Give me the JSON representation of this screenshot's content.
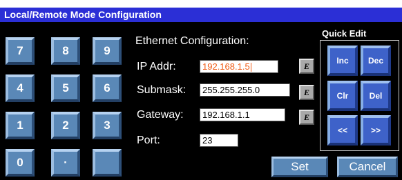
{
  "title": "Local/Remote Mode Configuration",
  "keypad": [
    "7",
    "8",
    "9",
    "4",
    "5",
    "6",
    "1",
    "2",
    "3",
    "0",
    "·",
    ""
  ],
  "ethernet": {
    "heading": "Ethernet Configuration:",
    "ip_label": "IP Addr:",
    "ip_value": "192.168.1.5",
    "submask_label": "Submask:",
    "submask_value": "255.255.255.0",
    "gateway_label": "Gateway:",
    "gateway_value": "192.168.1.1",
    "port_label": "Port:",
    "port_value": "23",
    "edit_label": "E"
  },
  "quick_edit": {
    "title": "Quick Edit",
    "inc": "Inc",
    "dec": "Dec",
    "clr": "Clr",
    "del": "Del",
    "left": "<<",
    "right": ">>"
  },
  "buttons": {
    "set": "Set",
    "cancel": "Cancel"
  },
  "colors": {
    "titlebar": "#2b2fd6",
    "active_text": "#f05a14",
    "panel": "#000000"
  }
}
